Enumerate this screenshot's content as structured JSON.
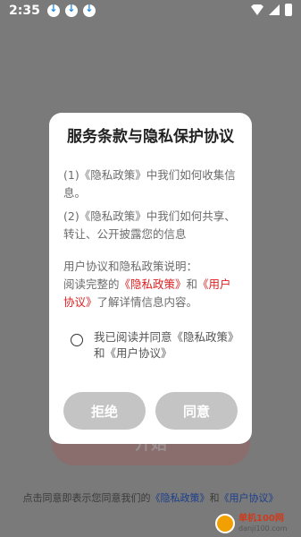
{
  "status_bar": {
    "time": "2:35"
  },
  "background": {
    "start_button_label": "开始",
    "agreement_prefix": "点击同意即表示您同意我们的",
    "privacy_link": "《隐私政策》",
    "and": "和",
    "user_link": "《用户协议》"
  },
  "dialog": {
    "title": "服务条款与隐私保护协议",
    "para1": "(1)《隐私政策》中我们如何收集信息。",
    "para2": "(2)《隐私政策》中我们如何共享、转让、公开披露您的信息",
    "para3_intro": "用户协议和隐私政策说明：",
    "para3_prefix": "阅读完整的",
    "para3_privacy": "《隐私政策》",
    "para3_and": "和",
    "para3_user": "《用户协议》",
    "para3_suffix": "了解详情信息内容。",
    "consent_text": "我已阅读并同意《隐私政策》和《用户协议》",
    "reject_label": "拒绝",
    "agree_label": "同意"
  },
  "watermark": {
    "name": "单机100网",
    "url": "danji100.com"
  },
  "colors": {
    "link_red": "#e02020",
    "button_gray": "#c4c4c4",
    "overlay": "#7a7a7a"
  }
}
